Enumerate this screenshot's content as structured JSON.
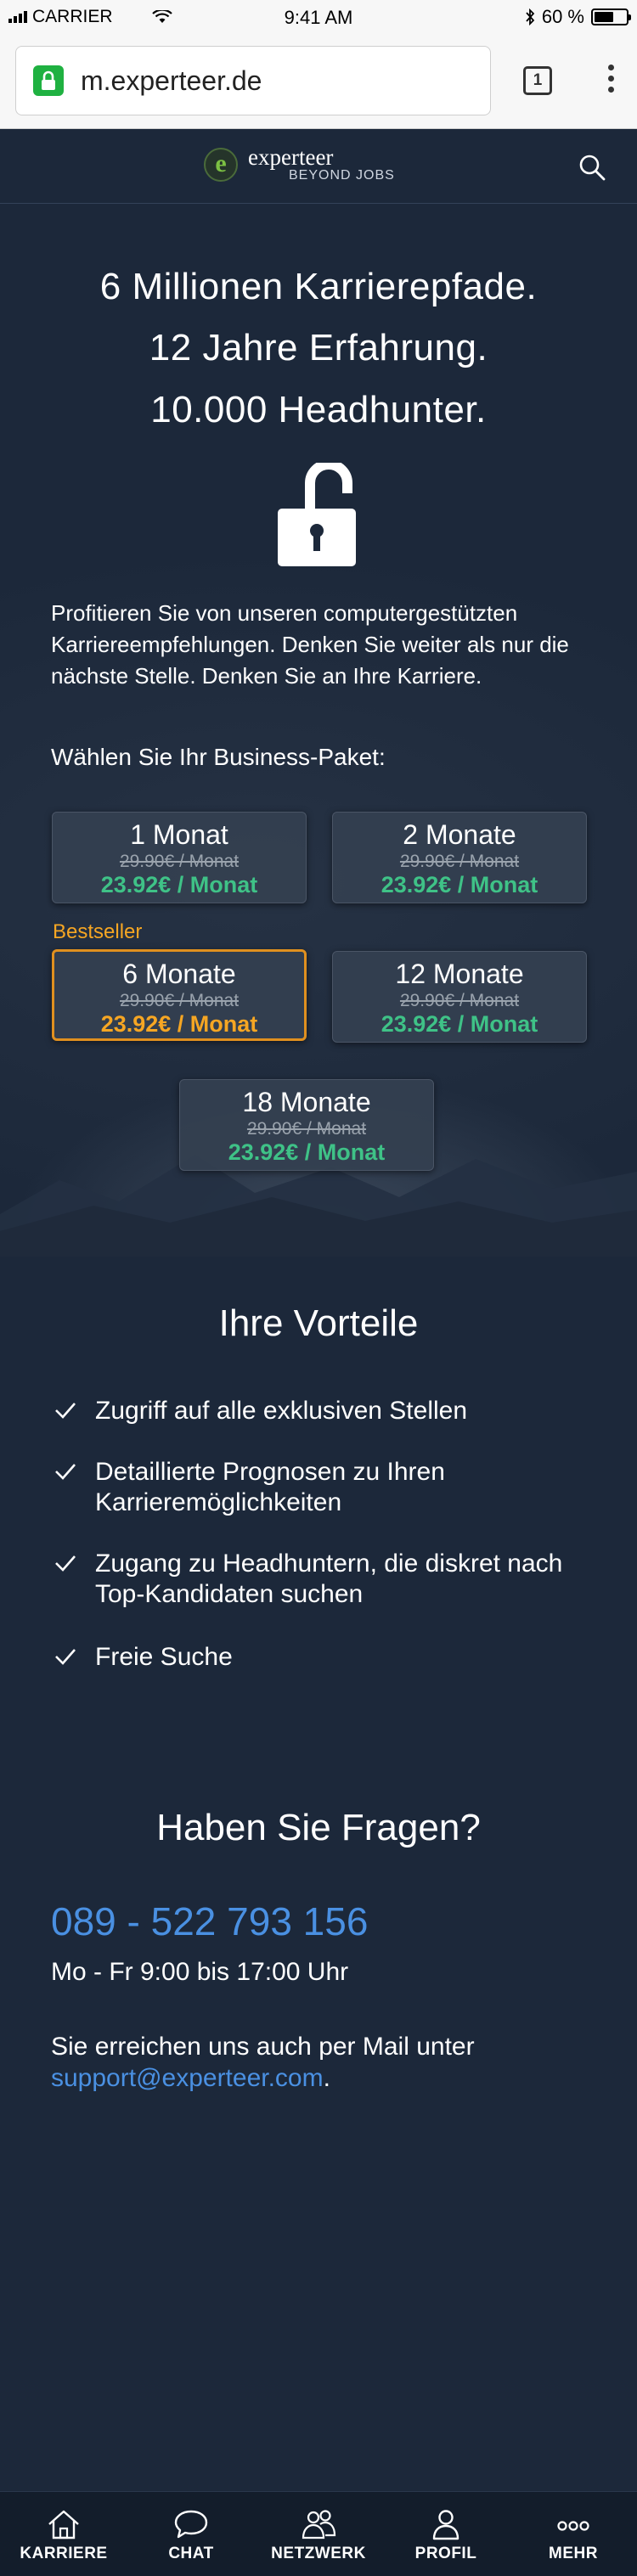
{
  "status_bar": {
    "carrier": "CARRIER",
    "time": "9:41 AM",
    "battery": "60 %",
    "battery_level": 0.6
  },
  "browser": {
    "url": "m.experteer.de",
    "tab_count": "1"
  },
  "header": {
    "logo_name": "experteer",
    "logo_tagline": "BEYOND JOBS"
  },
  "hero": {
    "headline_lines": [
      "6 Millionen Karrierepfade.",
      "12 Jahre Erfahrung.",
      "10.000 Headhunter."
    ],
    "intro": "Profitieren Sie von unseren computergestützten Karriereempfehlungen. Denken Sie weiter als nur die nächste Stelle. Denken Sie an Ihre Karriere.",
    "choose_label": "Wählen Sie Ihr Business-Paket:",
    "bestseller_label": "Bestseller"
  },
  "packages": [
    {
      "duration": "1 Monat",
      "old_price": "29.90€ / Monat",
      "price": "23.92€ / Monat",
      "selected": false
    },
    {
      "duration": "2 Monate",
      "old_price": "29.90€ / Monat",
      "price": "23.92€ / Monat",
      "selected": false
    },
    {
      "duration": "6 Monate",
      "old_price": "29.90€ / Monat",
      "price": "23.92€ / Monat",
      "selected": true
    },
    {
      "duration": "12 Monate",
      "old_price": "29.90€ / Monat",
      "price": "23.92€ / Monat",
      "selected": false
    },
    {
      "duration": "18 Monate",
      "old_price": "29.90€ / Monat",
      "price": "23.92€ / Monat",
      "selected": false
    }
  ],
  "benefits": {
    "title": "Ihre Vorteile",
    "items": [
      "Zugriff auf alle exklusiven Stellen",
      "Detaillierte Prognosen zu Ihren Karrieremöglichkeiten",
      "Zugang zu Headhuntern, die diskret nach Top-Kandidaten suchen",
      "Freie Suche"
    ]
  },
  "questions": {
    "title": "Haben Sie Fragen?",
    "phone": "089 - 522 793 156",
    "hours": "Mo - Fr 9:00 bis 17:00 Uhr",
    "mail_prefix": "Sie erreichen uns auch per Mail unter",
    "email": "support@experteer.com",
    "mail_suffix": "."
  },
  "nav": [
    {
      "label": "KARRIERE",
      "icon": "home-icon"
    },
    {
      "label": "CHAT",
      "icon": "chat-icon"
    },
    {
      "label": "NETZWERK",
      "icon": "network-icon"
    },
    {
      "label": "PROFIL",
      "icon": "profile-icon"
    },
    {
      "label": "MEHR",
      "icon": "more-icon"
    }
  ],
  "colors": {
    "background": "#1c283a",
    "price_green": "#3fc287",
    "bestseller_orange": "#f6a623",
    "link_blue": "#4a90e2"
  }
}
